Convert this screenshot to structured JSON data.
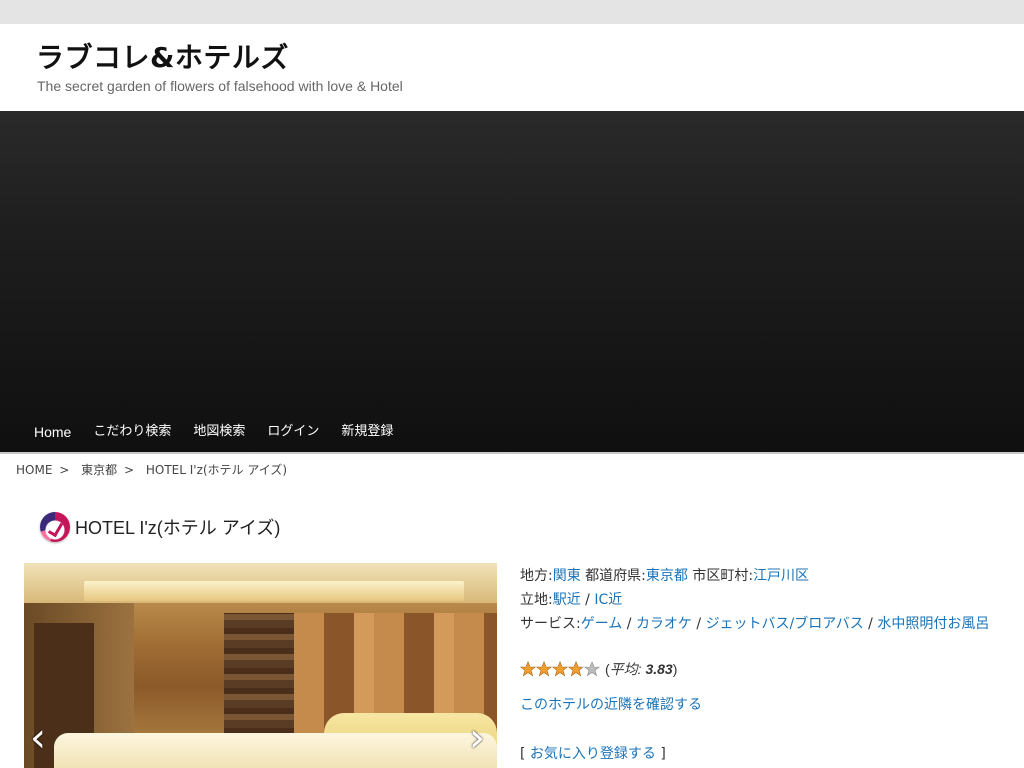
{
  "site": {
    "title": "ラブコレ&ホテルズ",
    "tagline": "The secret garden of flowers of falsehood with love & Hotel"
  },
  "nav": [
    "Home",
    "こだわり検索",
    "地図検索",
    "ログイン",
    "新規登録"
  ],
  "breadcrumb": {
    "home": "HOME",
    "prefecture": "東京都",
    "current": "HOTEL I'z(ホテル アイズ)",
    "separator": ">"
  },
  "hotel": {
    "name": "HOTEL I'z(ホテル アイズ)",
    "region_label": "地方",
    "region": "関東",
    "prefecture_label": "都道府県",
    "prefecture": "東京都",
    "city_label": "市区町村",
    "city": "江戸川区",
    "location_label": "立地",
    "locations": [
      "駅近",
      "IC近"
    ],
    "service_label": "サービス",
    "services": [
      "ゲーム",
      "カラオケ",
      "ジェットバス/ブロアバス",
      "水中照明付お風呂"
    ],
    "colon": ":",
    "slash": "/"
  },
  "rating": {
    "stars_total": 5,
    "average": 3.83,
    "avg_label": "平均:",
    "avg_value": "3.83"
  },
  "links": {
    "nearby": "このホテルの近隣を確認する",
    "favorite": "お気に入り登録する",
    "bracket_open": "[",
    "bracket_close": "]"
  },
  "gallery": {
    "prev_icon": "chevron-left-icon",
    "next_icon": "chevron-right-icon"
  },
  "colors": {
    "link": "#1a73b8",
    "star": "#f0a030"
  }
}
